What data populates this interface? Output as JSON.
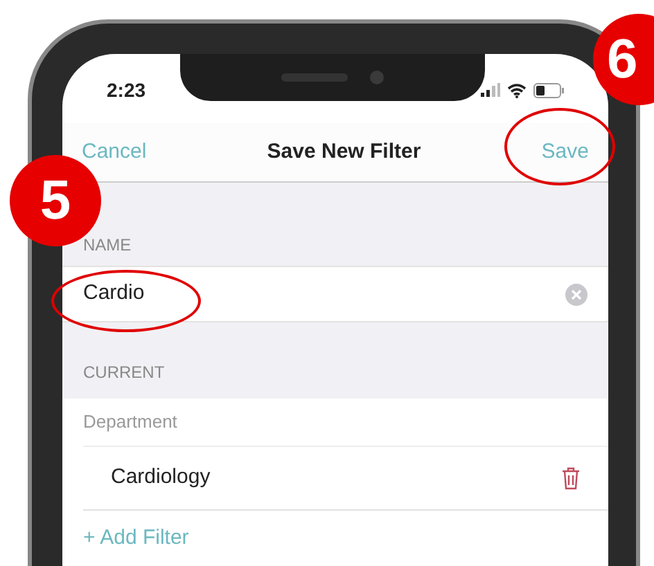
{
  "status_bar": {
    "time": "2:23"
  },
  "nav_bar": {
    "cancel": "Cancel",
    "title": "Save New Filter",
    "save": "Save"
  },
  "name_section": {
    "header": "NAME",
    "field_value": "Cardio"
  },
  "current_section": {
    "header": "CURRENT",
    "group_label": "Department",
    "filters": [
      "Cardiology"
    ],
    "add_filter": "+ Add Filter"
  },
  "callouts": [
    {
      "number": "5"
    },
    {
      "number": "6"
    }
  ]
}
